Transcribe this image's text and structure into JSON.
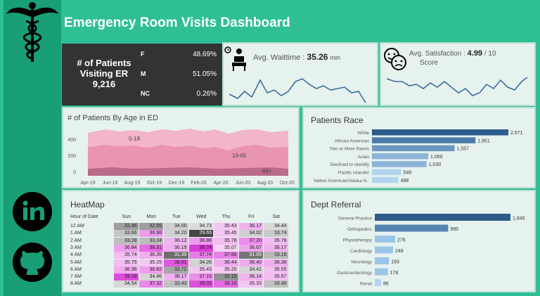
{
  "header": {
    "title": "Emergency Room Visits Dashboard"
  },
  "sidebar": {
    "logo": "caduceus-icon",
    "links": [
      "linkedin-icon",
      "github-icon"
    ]
  },
  "patients_card": {
    "title_line1": "# of Patients",
    "title_line2": "Visiting ER",
    "count": "9,216",
    "genders": [
      {
        "label": "F",
        "value": "48.69%"
      },
      {
        "label": "M",
        "value": "51.05%"
      },
      {
        "label": "NC",
        "value": "0.26%"
      }
    ]
  },
  "wait_card": {
    "label": "Avg. Waittime :",
    "value": "35.26",
    "unit": "min",
    "icon": "waiting-person-icon"
  },
  "sat_card": {
    "label": "Avg. Satisfaction :",
    "value": "4.99",
    "suffix": "/ 10",
    "sub": "Score",
    "icon": "happy-sad-faces-icon"
  },
  "age_chart": {
    "title": "# of Patients By Age in ED",
    "y_ticks": [
      "400",
      "200",
      "0"
    ],
    "x_ticks": [
      "Apr-19",
      "Jun-19",
      "Aug-19",
      "Oct-19",
      "Dec-19",
      "Feb-20",
      "Apr-20",
      "Jun-20",
      "Aug-20",
      "Oct-20"
    ],
    "band_labels": [
      "0-18",
      "19-65",
      "66+"
    ]
  },
  "chart_data": [
    {
      "type": "bar",
      "title": "Patients Race",
      "categories": [
        "White",
        "African American",
        "Two or More Races",
        "Asian",
        "Declined to Identify",
        "Pacific Islander",
        "Native American/Alaska N.."
      ],
      "values": [
        2571,
        1951,
        1557,
        1060,
        1030,
        549,
        498
      ],
      "value_labels": [
        "2,571",
        "1,951",
        "1,557",
        "1,060",
        "1,030",
        "549",
        "498"
      ],
      "colors": [
        "#2d5b8b",
        "#4b79a8",
        "#6b96c0",
        "#8db3d8",
        "#8db3d8",
        "#b3d4ef",
        "#b3d4ef"
      ]
    },
    {
      "type": "bar",
      "title": "Dept Referral",
      "categories": [
        "General Practice",
        "Orthopedics",
        "Physiotherapy",
        "Cardiology",
        "Neurology",
        "Gastroenterology",
        "Renal"
      ],
      "values": [
        1840,
        995,
        276,
        248,
        193,
        178,
        86
      ],
      "value_labels": [
        "1,840",
        "995",
        "276",
        "248",
        "193",
        "178",
        "86"
      ],
      "colors": [
        "#2d5b8b",
        "#5684b3",
        "#9bc5e8",
        "#9bc5e8",
        "#9bc5e8",
        "#9bc5e8",
        "#b3d4ef"
      ]
    }
  ],
  "heatmap": {
    "title": "HeatMap",
    "row_header": "Hour of Date",
    "days": [
      "Sun",
      "Mon",
      "Tue",
      "Wed",
      "Thu",
      "Fri",
      "Sat"
    ],
    "rows": [
      {
        "hour": "12 AM",
        "vals": [
          "32.46",
          "32.55",
          "34.00",
          "34.73",
          "35.43",
          "36.17",
          "34.44"
        ],
        "cols": [
          "#9e9e9e",
          "#9e9e9e",
          "#cfcfcf",
          "#dcdcdc",
          "#f4c6f2",
          "#f0b2ee",
          "#dadada"
        ]
      },
      {
        "hour": "1 AM",
        "vals": [
          "33.66",
          "36.98",
          "34.20",
          "29.65",
          "35.45",
          "34.02",
          "33.74"
        ],
        "cols": [
          "#c6c6c6",
          "#ee9cec",
          "#d1d1d1",
          "#444444",
          "#f4c6f2",
          "#cfcfcf",
          "#cacaca"
        ]
      },
      {
        "hour": "2 AM",
        "vals": [
          "33.28",
          "33.24",
          "36.12",
          "36.88",
          "35.76",
          "37.20",
          "35.76"
        ],
        "cols": [
          "#bdbdbd",
          "#bdbdbd",
          "#f0b4ee",
          "#ee9cec",
          "#f2bcf0",
          "#ec8dea",
          "#f2bcf0"
        ]
      },
      {
        "hour": "3 AM",
        "vals": [
          "36.84",
          "38.31",
          "36.19",
          "39.74",
          "35.07",
          "36.67",
          "36.17"
        ],
        "cols": [
          "#ee9eec",
          "#e36ae0",
          "#f0b2ee",
          "#d83cd6",
          "#f6d2f4",
          "#eea6ec",
          "#f0b2ee"
        ]
      },
      {
        "hour": "4 AM",
        "vals": [
          "35.74",
          "36.35",
          "31.39",
          "37.74",
          "37.66",
          "31.65",
          "33.16"
        ],
        "cols": [
          "#f2bcf0",
          "#f0aeee",
          "#6e6e6e",
          "#e67de3",
          "#e680e4",
          "#767676",
          "#b8b8b8"
        ]
      },
      {
        "hour": "5 AM",
        "vals": [
          "35.75",
          "35.25",
          "38.81",
          "34.26",
          "36.44",
          "36.40",
          "36.36"
        ],
        "cols": [
          "#f2bcf0",
          "#f4c8f2",
          "#df58dc",
          "#d2d2d2",
          "#efaaee",
          "#efacee",
          "#f0aeee"
        ]
      },
      {
        "hour": "6 AM",
        "vals": [
          "36.36",
          "36.82",
          "32.72",
          "35.43",
          "35.20",
          "34.41",
          "35.55"
        ],
        "cols": [
          "#f0aeee",
          "#ee9eec",
          "#a6a6a6",
          "#f4c6f2",
          "#f4c8f2",
          "#d6d6d6",
          "#f2c0f0"
        ]
      },
      {
        "hour": "7 AM",
        "vals": [
          "39.18",
          "34.46",
          "36.17",
          "37.15",
          "32.15",
          "36.14",
          "35.67"
        ],
        "cols": [
          "#dc4cd9",
          "#d6d6d6",
          "#f0b2ee",
          "#ec8eea",
          "#939393",
          "#f0b4ee",
          "#f2bef0"
        ]
      },
      {
        "hour": "8 AM",
        "vals": [
          "34.54",
          "37.32",
          "33.43",
          "39.02",
          "38.18",
          "35.33",
          "33.46"
        ],
        "cols": [
          "#d8d8d8",
          "#ea88e8",
          "#c0c0c0",
          "#dd52da",
          "#e36ae0",
          "#f4c6f2",
          "#c1c1c1"
        ]
      }
    ]
  }
}
